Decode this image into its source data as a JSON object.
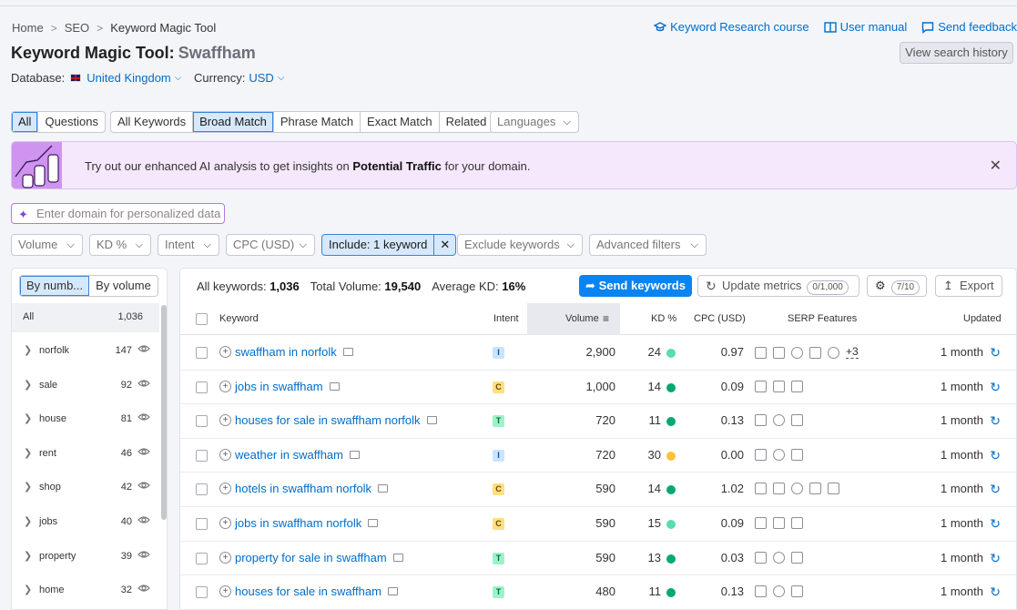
{
  "breadcrumb": [
    "Home",
    "SEO",
    "Keyword Magic Tool"
  ],
  "title": "Keyword Magic Tool:",
  "query": "Swaffham",
  "database_label": "Database:",
  "database_value": "United Kingdom",
  "currency_label": "Currency:",
  "currency_value": "USD",
  "links": {
    "course": "Keyword Research course",
    "manual": "User manual",
    "feedback": "Send feedback",
    "history": "View search history"
  },
  "tabs1": [
    "All",
    "Questions"
  ],
  "tabs2": [
    "All Keywords",
    "Broad Match",
    "Phrase Match",
    "Exact Match",
    "Related"
  ],
  "languages": "Languages",
  "banner": {
    "pre": "Try out our enhanced AI analysis to get insights on ",
    "bold": "Potential Traffic",
    "post": " for your domain."
  },
  "domain_placeholder": "Enter domain for personalized data",
  "filters": [
    "Volume",
    "KD %",
    "Intent",
    "CPC (USD)"
  ],
  "include_filter": "Include: 1 keyword",
  "exclude_filter": "Exclude keywords",
  "advanced_filter": "Advanced filters",
  "side": {
    "toggle": [
      "By numb...",
      "By volume"
    ],
    "all_label": "All",
    "all_count": "1,036",
    "groups": [
      {
        "name": "norfolk",
        "count": "147"
      },
      {
        "name": "sale",
        "count": "92"
      },
      {
        "name": "house",
        "count": "81"
      },
      {
        "name": "rent",
        "count": "46"
      },
      {
        "name": "shop",
        "count": "42"
      },
      {
        "name": "jobs",
        "count": "40"
      },
      {
        "name": "property",
        "count": "39"
      },
      {
        "name": "home",
        "count": "32"
      }
    ]
  },
  "stats": {
    "all_label": "All keywords:",
    "all_value": "1,036",
    "vol_label": "Total Volume:",
    "vol_value": "19,540",
    "kd_label": "Average KD:",
    "kd_value": "16%"
  },
  "buttons": {
    "send": "Send keywords",
    "update": "Update metrics",
    "update_pill": "0/1,000",
    "settings_pill": "7/10",
    "export": "Export"
  },
  "columns": {
    "keyword": "Keyword",
    "intent": "Intent",
    "volume": "Volume",
    "kd": "KD %",
    "cpc": "CPC (USD)",
    "serp": "SERP Features",
    "updated": "Updated"
  },
  "colors": {
    "kd_green_light": "#59ddaa",
    "kd_green_dark": "#00a96e",
    "kd_yellow": "#fdc23c",
    "accent": "#006dca"
  },
  "rows": [
    {
      "keyword": "swaffham in norfolk",
      "intent": "I",
      "volume": "2,900",
      "kd": "24",
      "kd_color": "#59ddaa",
      "cpc": "0.97",
      "serp": [
        "search-icon",
        "image-icon",
        "video-icon",
        "ads-icon",
        "play-icon"
      ],
      "more": "+3",
      "updated": "1 month"
    },
    {
      "keyword": "jobs in swaffham",
      "intent": "C",
      "volume": "1,000",
      "kd": "14",
      "kd_color": "#00a96e",
      "cpc": "0.09",
      "serp": [
        "search-icon",
        "briefcase-icon",
        "list-icon"
      ],
      "more": "",
      "updated": "1 month"
    },
    {
      "keyword": "houses for sale in swaffham norfolk",
      "intent": "T",
      "volume": "720",
      "kd": "11",
      "kd_color": "#00a96e",
      "cpc": "0.13",
      "serp": [
        "search-icon",
        "video-icon",
        "list-icon"
      ],
      "more": "",
      "updated": "1 month"
    },
    {
      "keyword": "weather in swaffham",
      "intent": "I",
      "volume": "720",
      "kd": "30",
      "kd_color": "#fdc23c",
      "cpc": "0.00",
      "serp": [
        "search-icon",
        "question-icon",
        "list-icon"
      ],
      "more": "",
      "updated": "1 month"
    },
    {
      "keyword": "hotels in swaffham norfolk",
      "intent": "C",
      "volume": "590",
      "kd": "14",
      "kd_color": "#00a96e",
      "cpc": "1.02",
      "serp": [
        "search-icon",
        "image-icon",
        "video-icon",
        "hotel-icon",
        "list-icon"
      ],
      "more": "",
      "updated": "1 month"
    },
    {
      "keyword": "jobs in swaffham norfolk",
      "intent": "C",
      "volume": "590",
      "kd": "15",
      "kd_color": "#59ddaa",
      "cpc": "0.09",
      "serp": [
        "search-icon",
        "briefcase-icon",
        "list-icon"
      ],
      "more": "",
      "updated": "1 month"
    },
    {
      "keyword": "property for sale in swaffham",
      "intent": "T",
      "volume": "590",
      "kd": "13",
      "kd_color": "#00a96e",
      "cpc": "0.03",
      "serp": [
        "search-icon",
        "video-icon",
        "list-icon"
      ],
      "more": "",
      "updated": "1 month"
    },
    {
      "keyword": "houses for sale in swaffham",
      "intent": "T",
      "volume": "480",
      "kd": "11",
      "kd_color": "#00a96e",
      "cpc": "0.13",
      "serp": [
        "search-icon",
        "video-icon",
        "list-icon"
      ],
      "more": "",
      "updated": "1 month"
    }
  ]
}
